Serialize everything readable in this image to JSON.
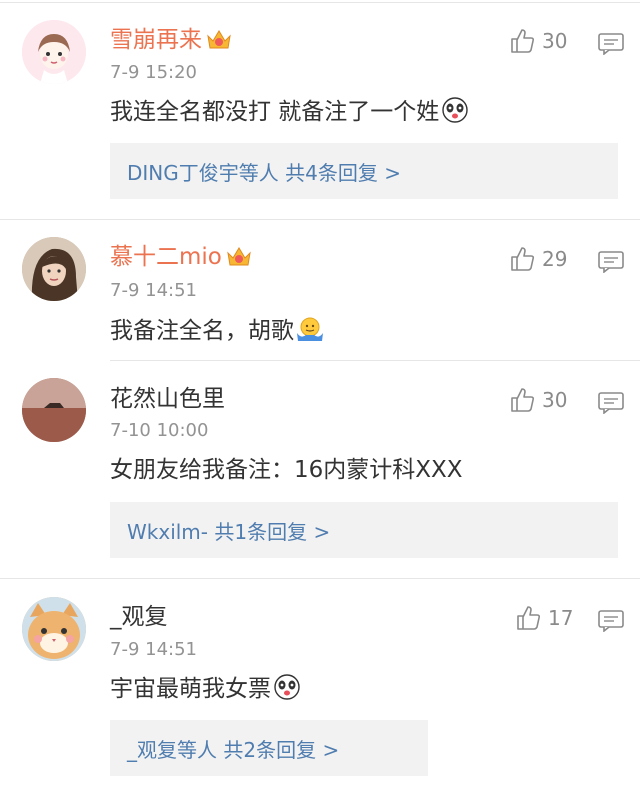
{
  "comments": [
    {
      "username": "雪崩再来",
      "time": "7-9 15:20",
      "text": "我连全名都没打 就备注了一个姓",
      "likes": "30",
      "emoji": "panda-icon",
      "reply_summary": "DING丁俊宇等人  共4条回复 >"
    },
    {
      "username": "慕十二mio",
      "time": "7-9 14:51",
      "text": "我备注全名，胡歌",
      "likes": "29",
      "emoji": "shrug-emoji"
    },
    {
      "username": "花然山色里",
      "time": "7-10 10:00",
      "text": "女朋友给我备注：16内蒙计科XXX",
      "likes": "30",
      "reply_summary": "Wkxilm-  共1条回复 >"
    },
    {
      "username": "_观复",
      "time": "7-9 14:51",
      "text": "宇宙最萌我女票",
      "likes": "17",
      "emoji": "panda-icon",
      "reply_summary": "_观复等人  共2条回复 >"
    }
  ],
  "colors": {
    "vip_name": "#eb7350",
    "link": "#507daf",
    "meta": "#939393"
  }
}
